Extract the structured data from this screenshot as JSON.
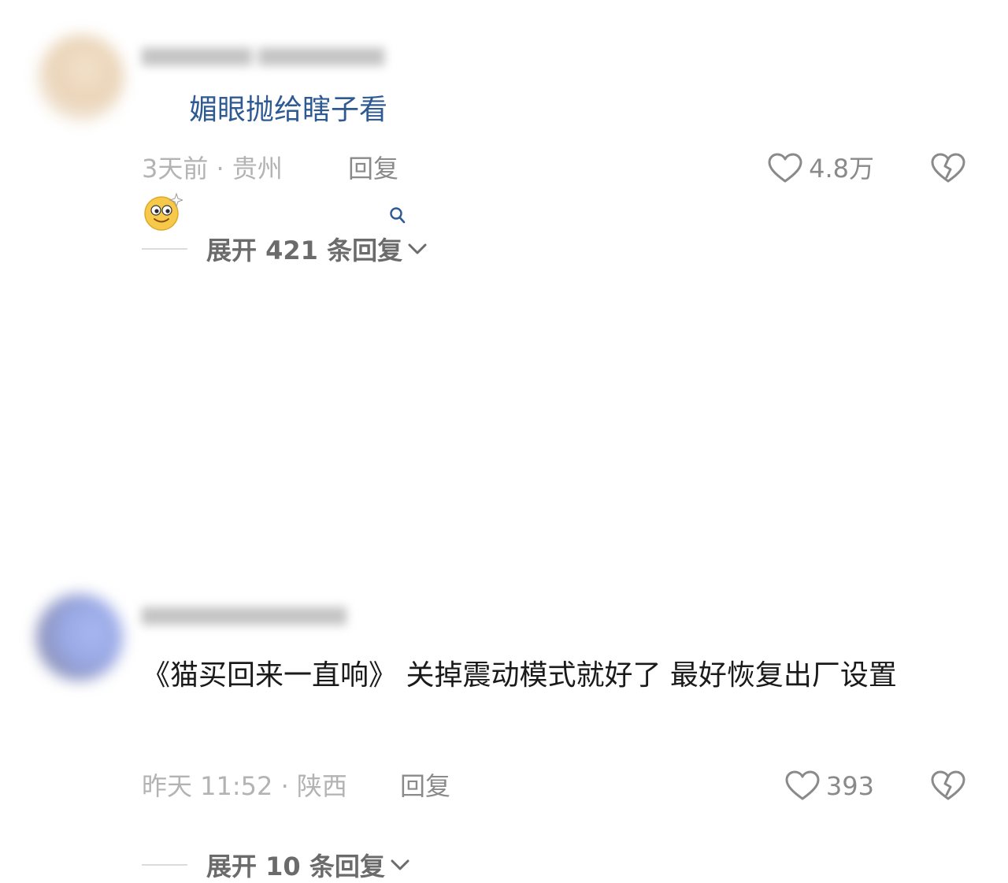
{
  "comments": [
    {
      "text": "媚眼抛给瞎子看",
      "time_location": "3天前 · 贵州",
      "reply_label": "回复",
      "like_count": "4.8万",
      "expand_label": "展开 421 条回复",
      "emoji_icon": "smiling-face-sparkle-emoji",
      "text_color": "#2d5a93"
    },
    {
      "text": "《猫买回来一直响》 关掉震动模式就好了 最好恢复出厂设置",
      "time_location": "昨天 11:52 · 陕西",
      "reply_label": "回复",
      "like_count": "393",
      "expand_label": "展开 10 条回复",
      "text_color": "#1a1a1a"
    }
  ],
  "colors": {
    "meta_gray": "#b3b3b3",
    "action_gray": "#8a8a8a",
    "expand_gray": "#6b6b6b",
    "link_blue": "#2d5a93"
  }
}
